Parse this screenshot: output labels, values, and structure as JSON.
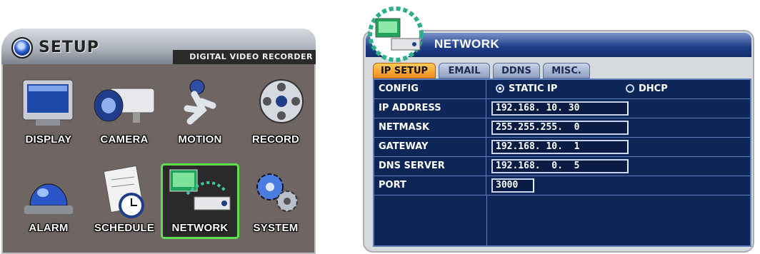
{
  "setup": {
    "title": "SETUP",
    "subtitle": "DIGITAL VIDEO RECORDER",
    "menu": [
      {
        "label": "DISPLAY",
        "icon": "monitor-icon",
        "selected": false
      },
      {
        "label": "CAMERA",
        "icon": "camera-icon",
        "selected": false
      },
      {
        "label": "MOTION",
        "icon": "running-person-icon",
        "selected": false
      },
      {
        "label": "RECORD",
        "icon": "film-reel-icon",
        "selected": false
      },
      {
        "label": "ALARM",
        "icon": "siren-dome-icon",
        "selected": false
      },
      {
        "label": "SCHEDULE",
        "icon": "notepad-clock-icon",
        "selected": false
      },
      {
        "label": "NETWORK",
        "icon": "networked-computers-icon",
        "selected": true
      },
      {
        "label": "SYSTEM",
        "icon": "gears-icon",
        "selected": false
      }
    ],
    "colors": {
      "panel_bg": "#6f6563",
      "selection": "#5de04a"
    }
  },
  "network": {
    "title": "NETWORK",
    "tabs": [
      {
        "label": "IP SETUP",
        "active": true
      },
      {
        "label": "EMAIL",
        "active": false
      },
      {
        "label": "DDNS",
        "active": false
      },
      {
        "label": "MISC.",
        "active": false
      }
    ],
    "rows": {
      "config": {
        "label": "CONFIG",
        "options": [
          {
            "label": "STATIC IP",
            "checked": true
          },
          {
            "label": "DHCP",
            "checked": false
          }
        ]
      },
      "ip_address": {
        "label": "IP ADDRESS",
        "value": "192.168. 10. 30"
      },
      "netmask": {
        "label": "NETMASK",
        "value": "255.255.255.  0"
      },
      "gateway": {
        "label": "GATEWAY",
        "value": "192.168. 10.  1"
      },
      "dns_server": {
        "label": "DNS SERVER",
        "value": "192.168.  0.  5"
      },
      "port": {
        "label": "PORT",
        "value": "3000"
      }
    },
    "colors": {
      "table_bg": "#0e2557",
      "active_tab": "#f08a1b",
      "header": "#1d3c86"
    }
  }
}
